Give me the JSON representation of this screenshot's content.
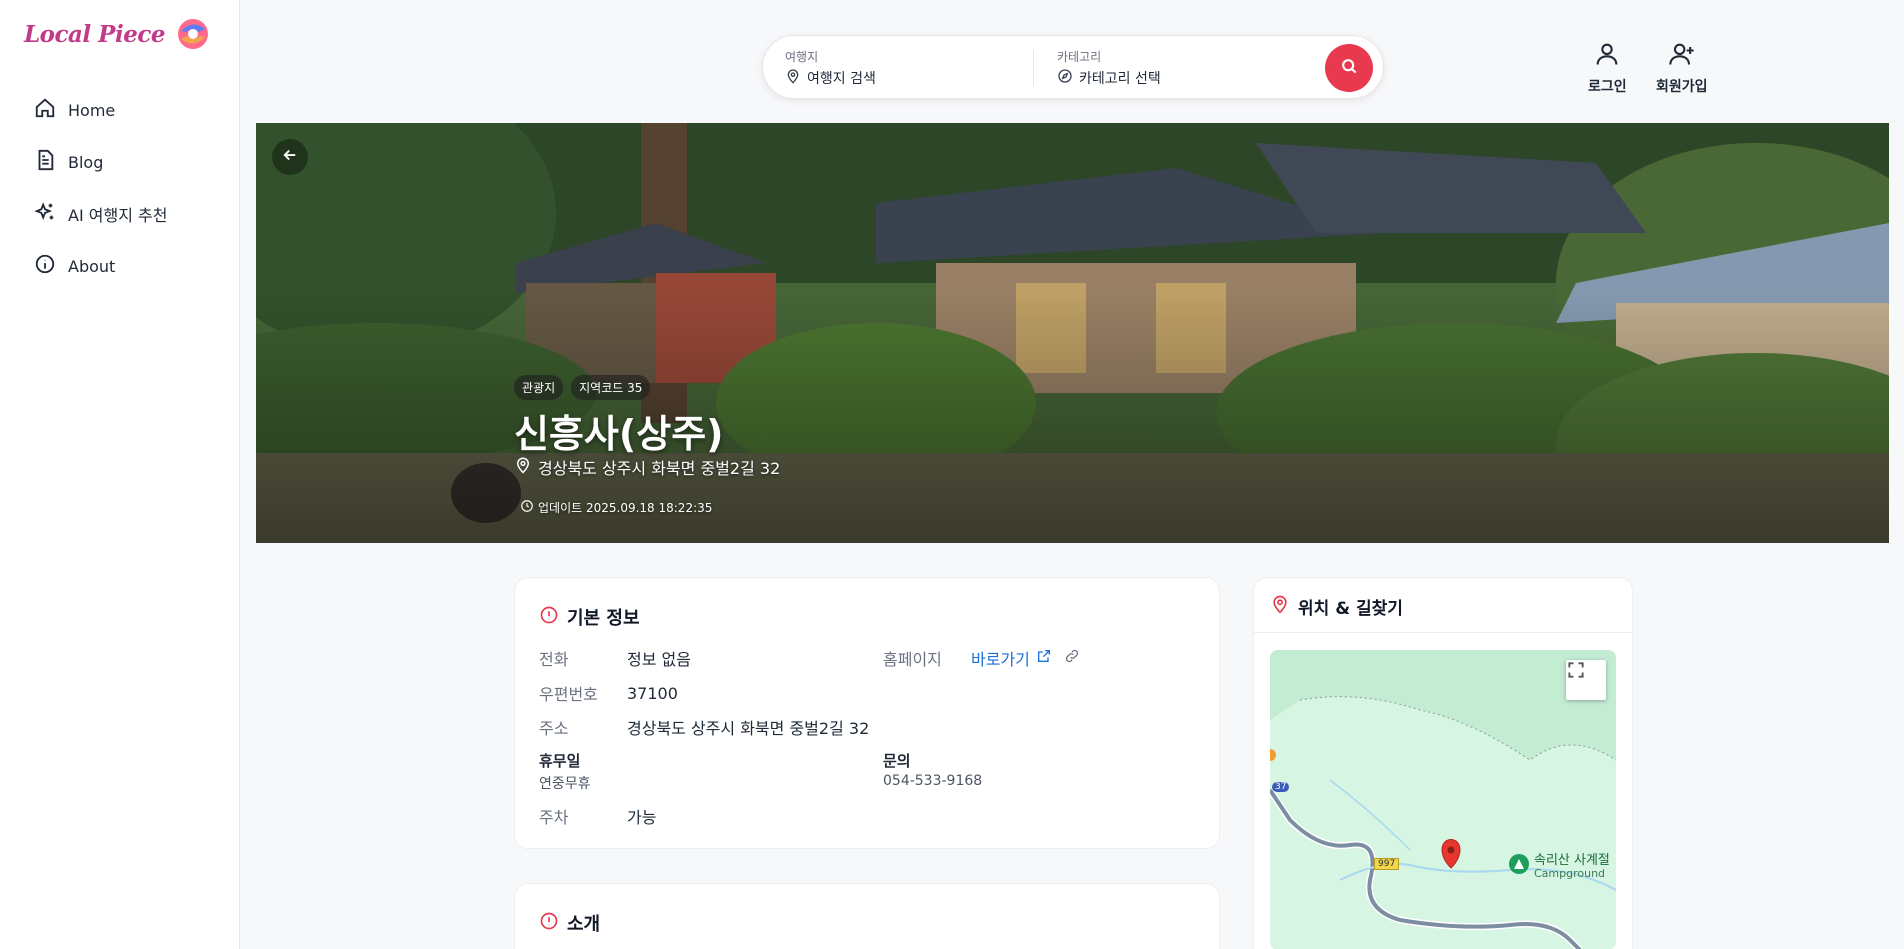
{
  "brand": {
    "name": "Local Piece"
  },
  "nav": [
    {
      "label": "Home",
      "icon": "home-icon"
    },
    {
      "label": "Blog",
      "icon": "document-icon"
    },
    {
      "label": "AI 여행지 추천",
      "icon": "sparkles-icon"
    },
    {
      "label": "About",
      "icon": "info-icon"
    }
  ],
  "search": {
    "destination_label": "여행지",
    "destination_value": "여행지 검색",
    "category_label": "카테고리",
    "category_value": "카테고리 선택"
  },
  "auth": {
    "login": "로그인",
    "signup": "회원가입"
  },
  "hero": {
    "badges": [
      "관광지",
      "지역코드 35"
    ],
    "title": "신흥사(상주)",
    "address": "경상북도 상주시 화북면 중벌2길 32",
    "updated": "업데이트 2025.09.18 18:22:35"
  },
  "basic_info": {
    "title": "기본 정보",
    "phone_label": "전화",
    "phone_value": "정보 없음",
    "homepage_label": "홈페이지",
    "homepage_value": "바로가기",
    "postal_label": "우편번호",
    "postal_value": "37100",
    "address_label": "주소",
    "address_value": "경상북도 상주시 화북면 중벌2길 32",
    "closed_label": "휴무일",
    "closed_value": "연중무휴",
    "inquiry_label": "문의",
    "inquiry_value": "054-533-9168",
    "parking_label": "주차",
    "parking_value": "가능"
  },
  "intro": {
    "title": "소개"
  },
  "map_card": {
    "title": "위치 & 길찾기",
    "road_37": "37",
    "road_997": "997",
    "poi_name": "속리산 사계절",
    "poi_type": "Campground"
  },
  "colors": {
    "accent": "#e8394f",
    "link": "#1d6fd8",
    "brand": "#c23b8a"
  }
}
